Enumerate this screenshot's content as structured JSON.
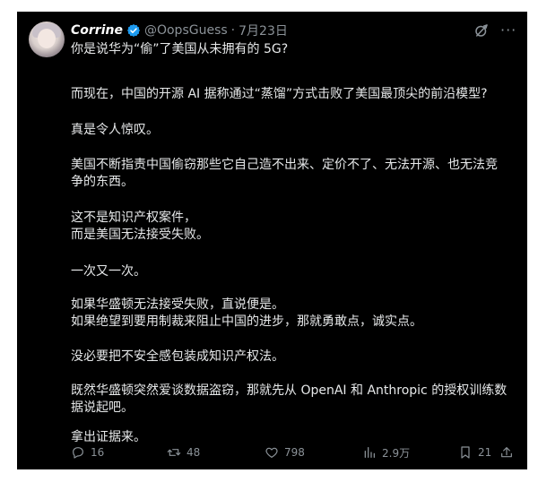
{
  "post": {
    "author_name": "Corrine",
    "handle": "@OopsGuess",
    "separator": "·",
    "date": "7月23日",
    "paragraphs": [
      "你是说华为“偷”了美国从未拥有的 5G?",
      "而现在，中国的开源 AI 据称通过“蒸馏”方式击败了美国最顶尖的前沿模型?",
      "真是令人惊叹。",
      "美国不断指责中国偷窃那些它自己造不出来、定价不了、无法开源、也无法竞\n争的东西。",
      "这不是知识产权案件，\n而是美国无法接受失败。",
      "一次又一次。",
      "如果华盛顿无法接受失败，直说便是。\n如果绝望到要用制裁来阻止中国的进步，那就勇敢点，诚实点。",
      "没必要把不安全感包装成知识产权法。",
      "既然华盛顿突然爱谈数据盗窃，那就先从 OpenAI 和 Anthropic 的授权训练数\n据说起吧。",
      "拿出证据来。"
    ]
  },
  "actions": {
    "replies": "16",
    "reposts": "48",
    "likes": "798",
    "views": "2.9万",
    "bookmarks": "21"
  },
  "colors": {
    "background": "#000000",
    "text": "#e7e9ea",
    "muted": "#8b9298",
    "verified": "#1d9bf0"
  },
  "icons": {
    "verified": "verified-badge-icon",
    "grok": "grok-icon",
    "more": "more-icon",
    "reply": "reply-icon",
    "repost": "repost-icon",
    "like": "like-icon",
    "views": "views-icon",
    "bookmark": "bookmark-icon",
    "share": "share-icon"
  }
}
